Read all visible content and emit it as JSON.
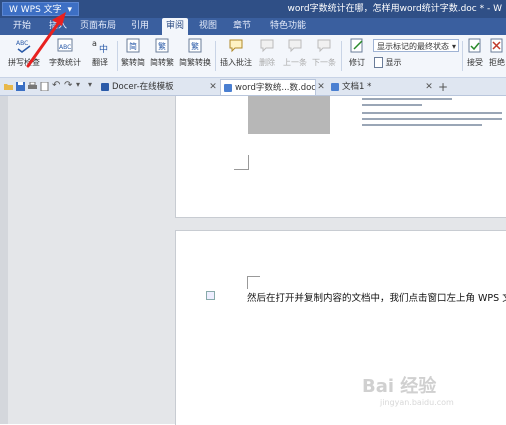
{
  "titlebar": {
    "app_button": "W WPS 文字",
    "doc_title": "word字数统计在哪，怎样用word统计字数.doc * - W"
  },
  "menu": {
    "items": [
      "开始",
      "插入",
      "页面布局",
      "引用",
      "审阅",
      "视图",
      "章节",
      "特色功能"
    ],
    "active": "审阅"
  },
  "ribbon": {
    "spell_check": "拼写检查",
    "word_count": "字数统计",
    "translate": "翻译",
    "trad_to_simp": "繁转简",
    "simp_to_trad": "简转繁",
    "trad_simp_convert": "简繁转换",
    "insert_comment": "插入批注",
    "delete": "删除",
    "prev": "上一条",
    "next": "下一条",
    "revise": "修订",
    "markup_dropdown": "显示标记的最终状态",
    "show": "显示",
    "accept": "接受",
    "reject": "拒绝"
  },
  "tabs": {
    "docer": "Docer-在线模板",
    "word_doc": "word字数统...数.doc *",
    "doc1": "文档1 *",
    "add": "+"
  },
  "document": {
    "paragraph": "然后在打开并复制内容的文档中，我们点击窗口左上角 WPS 文字后",
    "watermark": "Bai 经验",
    "watermark_sub": "jingyan.baidu.com"
  },
  "colors": {
    "title_bg": "#2f4f86",
    "menu_bg": "#3a5f9f",
    "ribbon_bg": "#f3f6fb",
    "arrow": "#e8211f"
  }
}
